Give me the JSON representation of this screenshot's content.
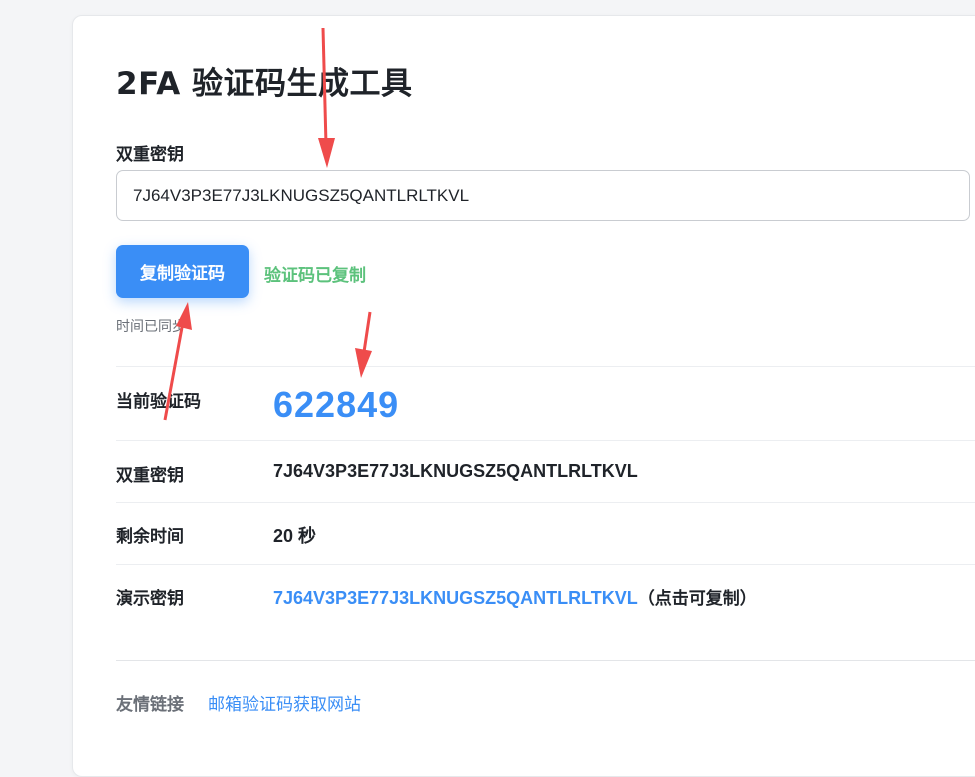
{
  "page": {
    "title": "2FA 验证码生成工具"
  },
  "form": {
    "secret_label": "双重密钥",
    "secret_value": "7J64V3P3E77J3LKNUGSZ5QANTLRLTKVL",
    "copy_button_label": "复制验证码",
    "copied_message": "验证码已复制",
    "sync_status": "时间已同步"
  },
  "results": {
    "rows": [
      {
        "label": "当前验证码",
        "value": "622849"
      },
      {
        "label": "双重密钥",
        "value": "7J64V3P3E77J3LKNUGSZ5QANTLRLTKVL"
      },
      {
        "label": "剩余时间",
        "value": "20 秒"
      },
      {
        "label": "演示密钥",
        "value": "7J64V3P3E77J3LKNUGSZ5QANTLRLTKVL",
        "hint": "（点击可复制）"
      }
    ]
  },
  "footer": {
    "links_label": "友情链接",
    "links": [
      {
        "label": "邮箱验证码获取网站"
      }
    ]
  },
  "colors": {
    "accent": "#3a8ef6",
    "success": "#5cc27c",
    "annotation_arrow": "#ef4b4b"
  }
}
